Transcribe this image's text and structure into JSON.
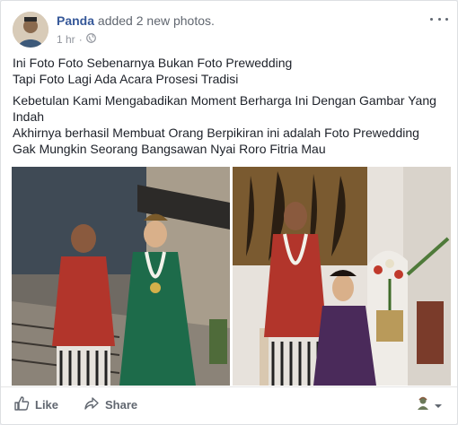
{
  "post": {
    "author": "Panda",
    "action": "added 2 new photos.",
    "time": "1 hr",
    "separator": "·",
    "paragraphs": [
      "Ini Foto Foto Sebenarnya Bukan Foto Prewedding",
      "Tapi Foto Lagi Ada Acara Prosesi Tradisi",
      "Kebetulan Kami Mengabadikan Moment Berharga Ini Dengan Gambar Yang Indah",
      "Akhirnya berhasil Membuat Orang Berpikiran ini adalah Foto Prewedding",
      "Gak Mungkin Seorang Bangsawan Nyai Roro Fitria Mau"
    ]
  },
  "actions": {
    "like_label": "Like",
    "share_label": "Share"
  },
  "colors": {
    "author": "#365899",
    "meta": "#90949c",
    "text": "#1d2129",
    "action_text": "#616770"
  },
  "icons": {
    "privacy": "globe-icon",
    "options": "more-options-icon",
    "like": "thumbs-up-icon",
    "share": "share-arrow-icon",
    "reaction_selector": "avatar-reaction-icon"
  }
}
